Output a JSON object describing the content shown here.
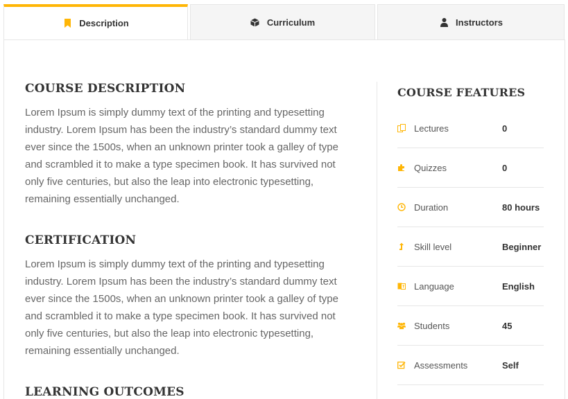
{
  "tabs": [
    {
      "label": "Description",
      "icon": "bookmark-icon",
      "active": true
    },
    {
      "label": "Curriculum",
      "icon": "cube-icon",
      "active": false
    },
    {
      "label": "Instructors",
      "icon": "user-icon",
      "active": false
    }
  ],
  "accent_color": "#ffb606",
  "description": {
    "sections": [
      {
        "title": "COURSE DESCRIPTION",
        "text": "Lorem Ipsum is simply dummy text of the printing and typesetting industry. Lorem Ipsum has been the industry’s standard dummy text ever since the 1500s, when an unknown printer took a galley of type and scrambled it to make a type specimen book. It has survived not only five centuries, but also the leap into electronic typesetting, remaining essentially unchanged."
      },
      {
        "title": "CERTIFICATION",
        "text": "Lorem Ipsum is simply dummy text of the printing and typesetting industry. Lorem Ipsum has been the industry’s standard dummy text ever since the 1500s, when an unknown printer took a galley of type and scrambled it to make a type specimen book. It has survived not only five centuries, but also the leap into electronic typesetting, remaining essentially unchanged."
      },
      {
        "title": "LEARNING OUTCOMES"
      }
    ]
  },
  "features": {
    "title": "COURSE FEATURES",
    "items": [
      {
        "icon": "files-icon",
        "label": "Lectures",
        "value": "0"
      },
      {
        "icon": "puzzle-icon",
        "label": "Quizzes",
        "value": "0"
      },
      {
        "icon": "clock-icon",
        "label": "Duration",
        "value": "80 hours"
      },
      {
        "icon": "level-up-icon",
        "label": "Skill level",
        "value": "Beginner"
      },
      {
        "icon": "language-icon",
        "label": "Language",
        "value": "English"
      },
      {
        "icon": "users-icon",
        "label": "Students",
        "value": "45"
      },
      {
        "icon": "check-square-icon",
        "label": "Assessments",
        "value": "Self"
      }
    ]
  }
}
